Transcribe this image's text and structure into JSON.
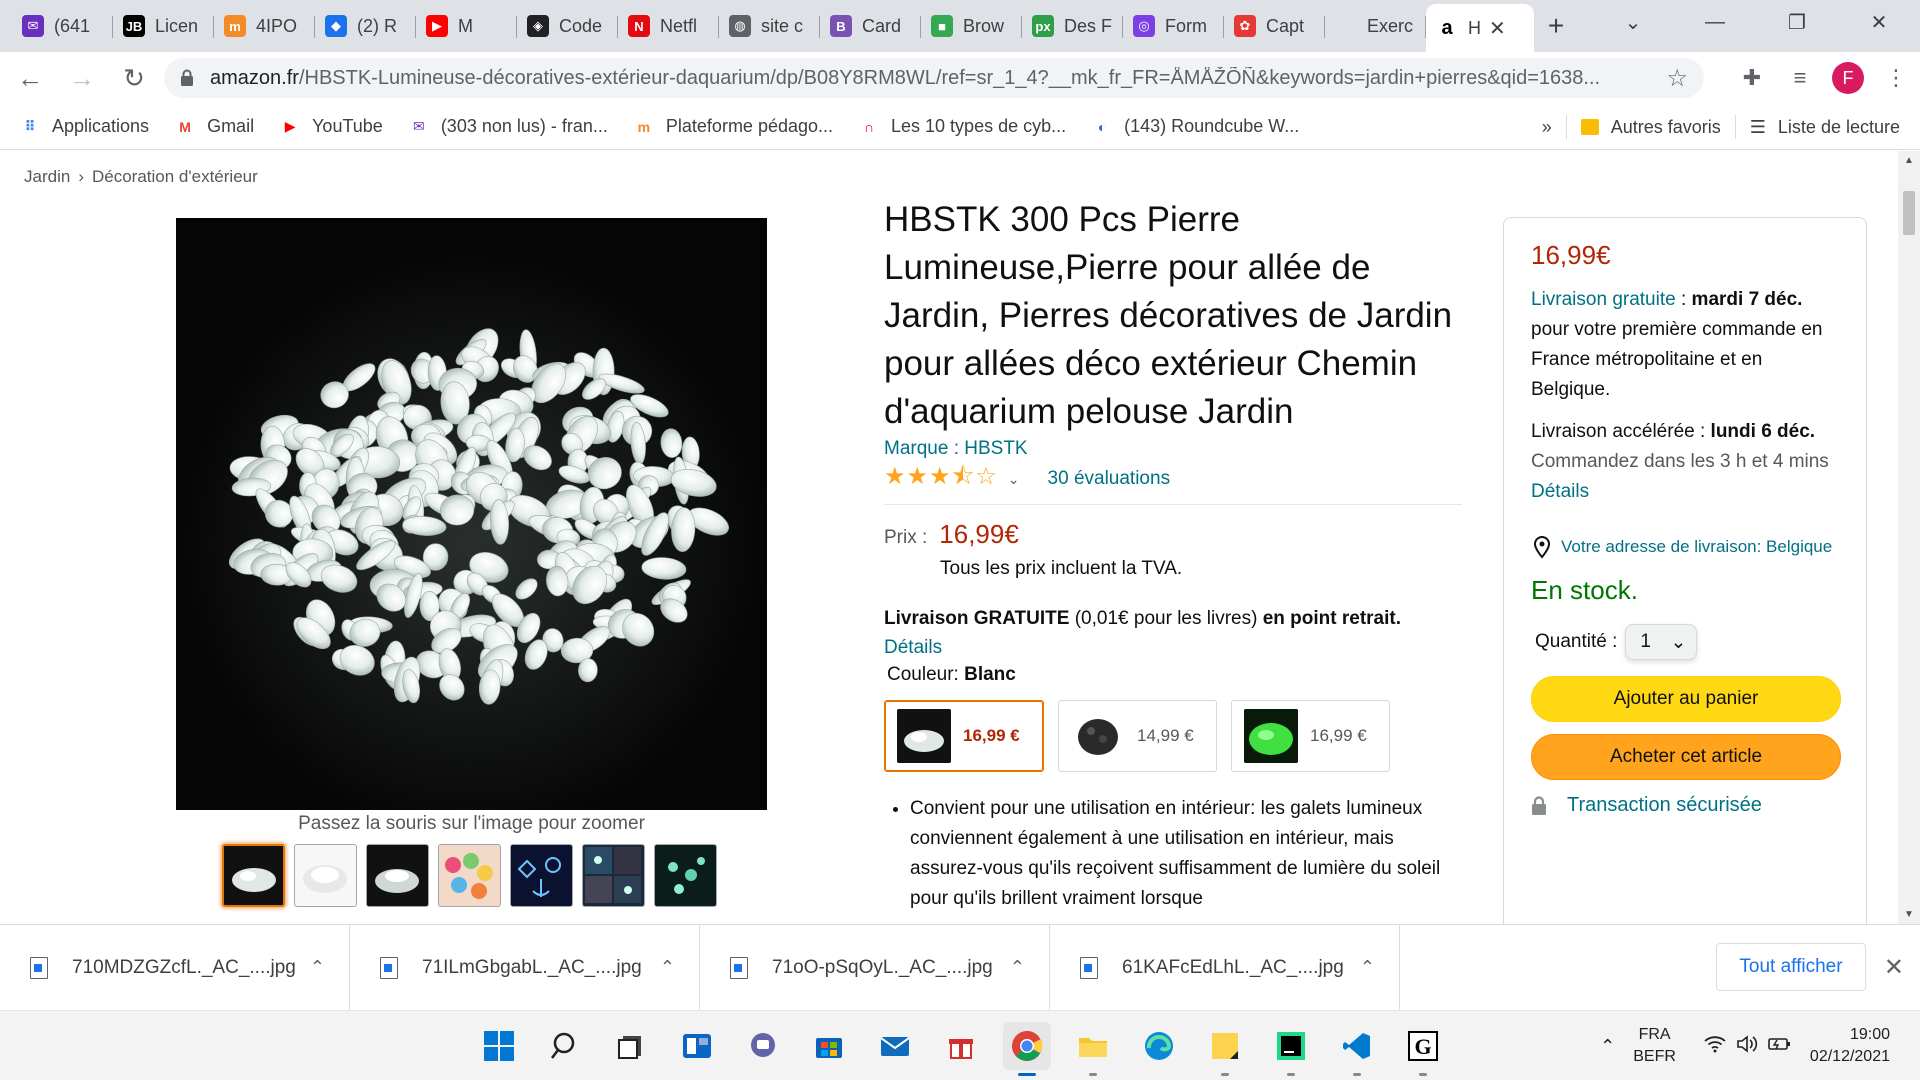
{
  "browser": {
    "tabs": [
      {
        "label": "(641",
        "color": "#6b2fbf",
        "glyph": "✉"
      },
      {
        "label": "Licen",
        "color": "#000000",
        "glyph": "JB"
      },
      {
        "label": "4IPO",
        "color": "#f28c28",
        "glyph": "m"
      },
      {
        "label": "(2) R",
        "color": "#1a73e8",
        "glyph": "◆"
      },
      {
        "label": "M",
        "color": "#ff0000",
        "glyph": "▶"
      },
      {
        "label": "Code",
        "color": "#202124",
        "glyph": "◈"
      },
      {
        "label": "Netfl",
        "color": "#e50914",
        "glyph": "N"
      },
      {
        "label": "site c",
        "color": "#5f6368",
        "glyph": "◍"
      },
      {
        "label": "Card",
        "color": "#7952b3",
        "glyph": "B"
      },
      {
        "label": "Brow",
        "color": "#34a853",
        "glyph": "■"
      },
      {
        "label": "Des F",
        "color": "#2e9e47",
        "glyph": "px"
      },
      {
        "label": "Form",
        "color": "#7b3fe4",
        "glyph": "◎"
      },
      {
        "label": "Capt",
        "color": "#e53935",
        "glyph": "✿"
      },
      {
        "label": "Exerc",
        "color": "#dee1e6",
        "glyph": ""
      }
    ],
    "active_tab": {
      "label": "H",
      "glyph": "a"
    },
    "url_host": "amazon.fr",
    "url_path": "/HBSTK-Lumineuse-décoratives-extérieur-daquarium/dp/B08Y8RM8WL/ref=sr_1_4?__mk_fr_FR=ÅMÅŽÕÑ&keywords=jardin+pierres&qid=1638...",
    "profile_initial": "F",
    "bookmarks": [
      {
        "label": "Applications",
        "icon": "apps-grid-icon"
      },
      {
        "label": "Gmail",
        "icon": "gmail-icon"
      },
      {
        "label": "YouTube",
        "icon": "youtube-icon"
      },
      {
        "label": "(303 non lus) - fran...",
        "icon": "mail-icon"
      },
      {
        "label": "Plateforme pédago...",
        "icon": "moodle-icon"
      },
      {
        "label": "Les 10 types de cyb...",
        "icon": "bookmark-icon"
      },
      {
        "label": "(143) Roundcube W...",
        "icon": "roundcube-icon"
      }
    ],
    "bookmarks_more": "»",
    "other_bookmarks": "Autres favoris",
    "reading_list": "Liste de lecture"
  },
  "page": {
    "breadcrumb": [
      "Jardin",
      "Décoration d'extérieur"
    ],
    "breadcrumb_sep": "›",
    "zoom_hint": "Passez la souris sur l'image pour zoomer",
    "title": "HBSTK 300 Pcs Pierre Lumineuse,Pierre pour allée de Jardin, Pierres décoratives de Jardin pour allées déco extérieur Chemin d'aquarium pelouse Jardin",
    "brand": "Marque : HBSTK",
    "rating_stars": 3.5,
    "rating_glyphs": "★★★⯪☆",
    "reviews": "30 évaluations",
    "price_label": "Prix :",
    "price": "16,99€",
    "tva": "Tous les prix incluent la TVA.",
    "delivery_bold": "Livraison GRATUITE",
    "delivery_mid": " (0,01€ pour les livres) ",
    "delivery_bold2": "en point retrait.",
    "delivery_link": "Détails",
    "color_label": "Couleur: ",
    "color_value": "Blanc",
    "swatches": [
      {
        "price": "16,99 €"
      },
      {
        "price": "14,99 €"
      },
      {
        "price": "16,99 €"
      }
    ],
    "bullet_text": "Convient pour une utilisation en intérieur: les galets lumineux conviennent également à une utilisation en intérieur, mais assurez-vous qu'ils reçoivent suffisamment de lumière du soleil pour qu'ils brillent vraiment lorsque"
  },
  "buybox": {
    "price": "16,99€",
    "free_delivery_link": "Livraison gratuite",
    "free_delivery_sep": " : ",
    "free_delivery_date": "mardi 7 déc.",
    "free_delivery_rest": "pour votre première commande en France métropolitaine et en Belgique.",
    "fast_label": "Livraison accélérée : ",
    "fast_date": "lundi 6 déc.",
    "order_within": "Commandez dans les 3 h et 4 mins ",
    "details_link": "Détails",
    "address": "Votre adresse de livraison: Belgique",
    "stock": "En stock.",
    "qty_label": "Quantité :",
    "qty_value": "1",
    "add_to_cart": "Ajouter au panier",
    "buy_now": "Acheter cet article",
    "secure": "Transaction sécurisée"
  },
  "downloads": {
    "items": [
      "710MDZGZcfL._AC_....jpg",
      "71ILmGbgabL._AC_....jpg",
      "71oO-pSqOyL._AC_....jpg",
      "61KAFcEdLhL._AC_....jpg"
    ],
    "show_all": "Tout afficher"
  },
  "taskbar": {
    "lang_top": "FRA",
    "lang_bottom": "BEFR",
    "time": "19:00",
    "date": "02/12/2021"
  }
}
